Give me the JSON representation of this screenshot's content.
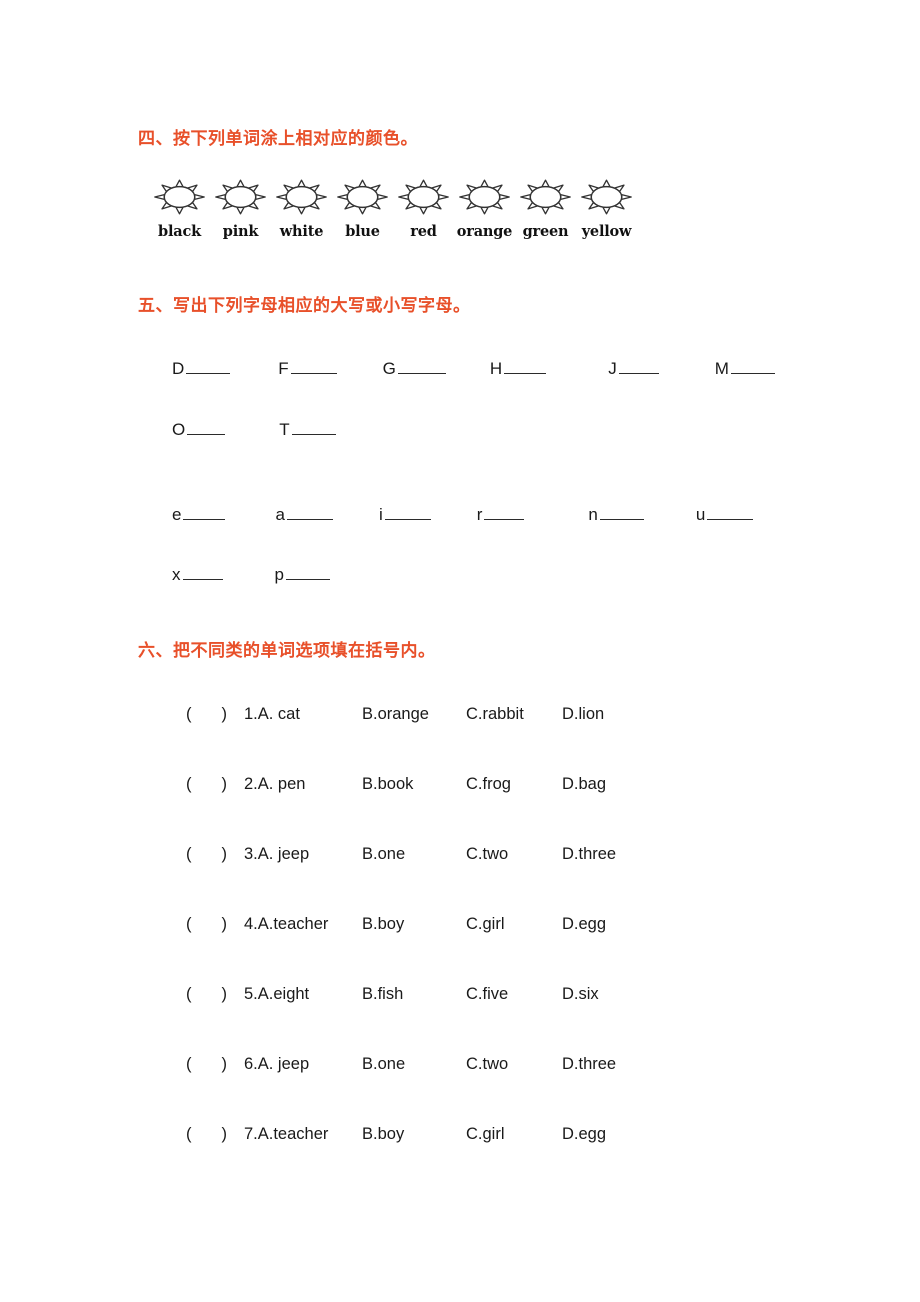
{
  "theme": {
    "heading_color": "#e8502a",
    "text_color": "#1a1a1a",
    "rule_color": "#2b2b2b",
    "page_background": "#ffffff"
  },
  "sections": {
    "four": {
      "heading": "四、按下列单词涂上相对应的颜色。",
      "icon_name": "sun-outline-icon",
      "color_words": [
        "black",
        "pink",
        "white",
        "blue",
        "red",
        "orange",
        "green",
        "yellow"
      ]
    },
    "five": {
      "heading": "五、写出下列字母相应的大写或小写字母。",
      "rows": [
        [
          {
            "letter": "D",
            "blank_width": 44
          },
          {
            "letter": "F",
            "blank_width": 46
          },
          {
            "letter": "G",
            "blank_width": 48
          },
          {
            "letter": "H",
            "blank_width": 42
          },
          {
            "letter": "J",
            "blank_width": 40
          },
          {
            "letter": "M",
            "blank_width": 44
          }
        ],
        [
          {
            "letter": "O",
            "blank_width": 38
          },
          {
            "letter": "T",
            "blank_width": 44
          }
        ],
        [
          {
            "letter": "e",
            "blank_width": 42
          },
          {
            "letter": "a",
            "blank_width": 46
          },
          {
            "letter": "i",
            "blank_width": 46
          },
          {
            "letter": "r",
            "blank_width": 40
          },
          {
            "letter": "n",
            "blank_width": 44
          },
          {
            "letter": "u",
            "blank_width": 46
          }
        ],
        [
          {
            "letter": "x",
            "blank_width": 40
          },
          {
            "letter": "p",
            "blank_width": 44
          }
        ]
      ]
    },
    "six": {
      "heading": "六、把不同类的单词选项填在括号内。",
      "bracket_open": "(",
      "bracket_close": ")",
      "questions": [
        {
          "stem": "1.A. cat",
          "options": [
            "B.orange",
            "C.rabbit",
            "D.lion"
          ],
          "stem_width": 118,
          "option_widths": [
            104,
            96,
            0
          ]
        },
        {
          "stem": "2.A. pen",
          "options": [
            "B.book",
            "C.frog",
            "D.bag"
          ],
          "stem_width": 118,
          "option_widths": [
            104,
            96,
            0
          ]
        },
        {
          "stem": "3.A. jeep",
          "options": [
            "B.one",
            "C.two",
            "D.three"
          ],
          "stem_width": 118,
          "option_widths": [
            104,
            96,
            0
          ]
        },
        {
          "stem": "4.A.teacher",
          "options": [
            "B.boy",
            "C.girl",
            "D.egg"
          ],
          "stem_width": 118,
          "option_widths": [
            104,
            96,
            0
          ]
        },
        {
          "stem": "5.A.eight",
          "options": [
            "B.fish",
            "C.five",
            "D.six"
          ],
          "stem_width": 118,
          "option_widths": [
            104,
            96,
            0
          ]
        },
        {
          "stem": "6.A. jeep",
          "options": [
            "B.one",
            "C.two",
            "D.three"
          ],
          "stem_width": 118,
          "option_widths": [
            104,
            96,
            0
          ]
        },
        {
          "stem": "7.A.teacher",
          "options": [
            "B.boy",
            "C.girl",
            "D.egg"
          ],
          "stem_width": 118,
          "option_widths": [
            104,
            96,
            0
          ]
        }
      ]
    }
  }
}
